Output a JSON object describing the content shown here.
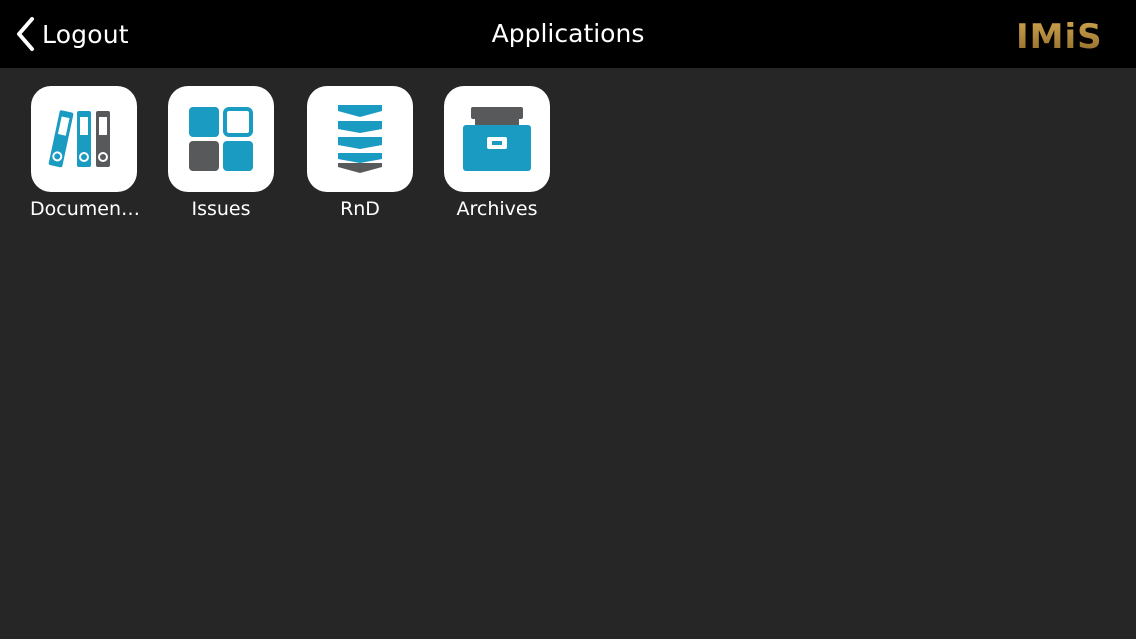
{
  "nav": {
    "back_label": "Logout",
    "title": "Applications",
    "logo_text": "IMiS"
  },
  "apps": [
    {
      "label": "Documen…",
      "icon": "binders-icon"
    },
    {
      "label": "Issues",
      "icon": "tiles-icon"
    },
    {
      "label": "RnD",
      "icon": "stacked-layers-icon"
    },
    {
      "label": "Archives",
      "icon": "archive-drawer-icon"
    }
  ],
  "colors": {
    "background": "#262627",
    "nav_background": "#000000",
    "accent_blue": "#1a9bc2",
    "accent_gray": "#58595b",
    "logo_gold": "#b08a3e"
  }
}
